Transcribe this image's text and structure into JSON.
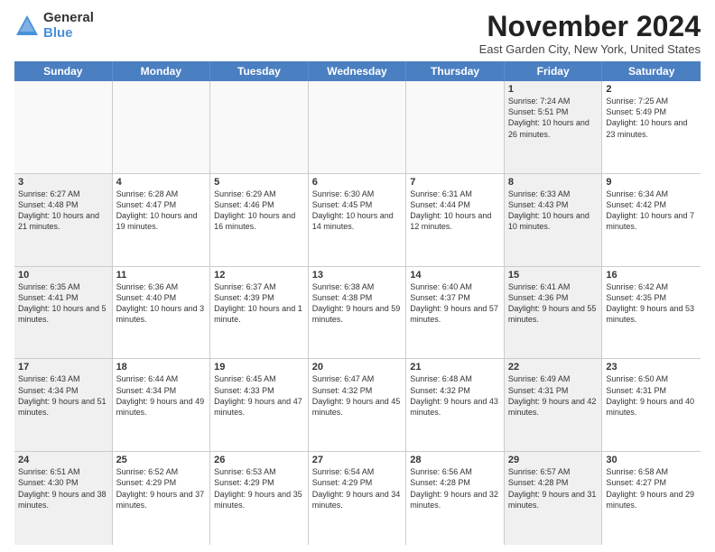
{
  "header": {
    "logo_general": "General",
    "logo_blue": "Blue",
    "month_title": "November 2024",
    "location": "East Garden City, New York, United States"
  },
  "weekdays": [
    "Sunday",
    "Monday",
    "Tuesday",
    "Wednesday",
    "Thursday",
    "Friday",
    "Saturday"
  ],
  "rows": [
    [
      {
        "day": "",
        "info": "",
        "empty": true
      },
      {
        "day": "",
        "info": "",
        "empty": true
      },
      {
        "day": "",
        "info": "",
        "empty": true
      },
      {
        "day": "",
        "info": "",
        "empty": true
      },
      {
        "day": "",
        "info": "",
        "empty": true
      },
      {
        "day": "1",
        "info": "Sunrise: 7:24 AM\nSunset: 5:51 PM\nDaylight: 10 hours and 26 minutes.",
        "shaded": true
      },
      {
        "day": "2",
        "info": "Sunrise: 7:25 AM\nSunset: 5:49 PM\nDaylight: 10 hours and 23 minutes.",
        "shaded": false
      }
    ],
    [
      {
        "day": "3",
        "info": "Sunrise: 6:27 AM\nSunset: 4:48 PM\nDaylight: 10 hours and 21 minutes.",
        "shaded": true
      },
      {
        "day": "4",
        "info": "Sunrise: 6:28 AM\nSunset: 4:47 PM\nDaylight: 10 hours and 19 minutes.",
        "shaded": false
      },
      {
        "day": "5",
        "info": "Sunrise: 6:29 AM\nSunset: 4:46 PM\nDaylight: 10 hours and 16 minutes.",
        "shaded": false
      },
      {
        "day": "6",
        "info": "Sunrise: 6:30 AM\nSunset: 4:45 PM\nDaylight: 10 hours and 14 minutes.",
        "shaded": false
      },
      {
        "day": "7",
        "info": "Sunrise: 6:31 AM\nSunset: 4:44 PM\nDaylight: 10 hours and 12 minutes.",
        "shaded": false
      },
      {
        "day": "8",
        "info": "Sunrise: 6:33 AM\nSunset: 4:43 PM\nDaylight: 10 hours and 10 minutes.",
        "shaded": true
      },
      {
        "day": "9",
        "info": "Sunrise: 6:34 AM\nSunset: 4:42 PM\nDaylight: 10 hours and 7 minutes.",
        "shaded": false
      }
    ],
    [
      {
        "day": "10",
        "info": "Sunrise: 6:35 AM\nSunset: 4:41 PM\nDaylight: 10 hours and 5 minutes.",
        "shaded": true
      },
      {
        "day": "11",
        "info": "Sunrise: 6:36 AM\nSunset: 4:40 PM\nDaylight: 10 hours and 3 minutes.",
        "shaded": false
      },
      {
        "day": "12",
        "info": "Sunrise: 6:37 AM\nSunset: 4:39 PM\nDaylight: 10 hours and 1 minute.",
        "shaded": false
      },
      {
        "day": "13",
        "info": "Sunrise: 6:38 AM\nSunset: 4:38 PM\nDaylight: 9 hours and 59 minutes.",
        "shaded": false
      },
      {
        "day": "14",
        "info": "Sunrise: 6:40 AM\nSunset: 4:37 PM\nDaylight: 9 hours and 57 minutes.",
        "shaded": false
      },
      {
        "day": "15",
        "info": "Sunrise: 6:41 AM\nSunset: 4:36 PM\nDaylight: 9 hours and 55 minutes.",
        "shaded": true
      },
      {
        "day": "16",
        "info": "Sunrise: 6:42 AM\nSunset: 4:35 PM\nDaylight: 9 hours and 53 minutes.",
        "shaded": false
      }
    ],
    [
      {
        "day": "17",
        "info": "Sunrise: 6:43 AM\nSunset: 4:34 PM\nDaylight: 9 hours and 51 minutes.",
        "shaded": true
      },
      {
        "day": "18",
        "info": "Sunrise: 6:44 AM\nSunset: 4:34 PM\nDaylight: 9 hours and 49 minutes.",
        "shaded": false
      },
      {
        "day": "19",
        "info": "Sunrise: 6:45 AM\nSunset: 4:33 PM\nDaylight: 9 hours and 47 minutes.",
        "shaded": false
      },
      {
        "day": "20",
        "info": "Sunrise: 6:47 AM\nSunset: 4:32 PM\nDaylight: 9 hours and 45 minutes.",
        "shaded": false
      },
      {
        "day": "21",
        "info": "Sunrise: 6:48 AM\nSunset: 4:32 PM\nDaylight: 9 hours and 43 minutes.",
        "shaded": false
      },
      {
        "day": "22",
        "info": "Sunrise: 6:49 AM\nSunset: 4:31 PM\nDaylight: 9 hours and 42 minutes.",
        "shaded": true
      },
      {
        "day": "23",
        "info": "Sunrise: 6:50 AM\nSunset: 4:31 PM\nDaylight: 9 hours and 40 minutes.",
        "shaded": false
      }
    ],
    [
      {
        "day": "24",
        "info": "Sunrise: 6:51 AM\nSunset: 4:30 PM\nDaylight: 9 hours and 38 minutes.",
        "shaded": true
      },
      {
        "day": "25",
        "info": "Sunrise: 6:52 AM\nSunset: 4:29 PM\nDaylight: 9 hours and 37 minutes.",
        "shaded": false
      },
      {
        "day": "26",
        "info": "Sunrise: 6:53 AM\nSunset: 4:29 PM\nDaylight: 9 hours and 35 minutes.",
        "shaded": false
      },
      {
        "day": "27",
        "info": "Sunrise: 6:54 AM\nSunset: 4:29 PM\nDaylight: 9 hours and 34 minutes.",
        "shaded": false
      },
      {
        "day": "28",
        "info": "Sunrise: 6:56 AM\nSunset: 4:28 PM\nDaylight: 9 hours and 32 minutes.",
        "shaded": false
      },
      {
        "day": "29",
        "info": "Sunrise: 6:57 AM\nSunset: 4:28 PM\nDaylight: 9 hours and 31 minutes.",
        "shaded": true
      },
      {
        "day": "30",
        "info": "Sunrise: 6:58 AM\nSunset: 4:27 PM\nDaylight: 9 hours and 29 minutes.",
        "shaded": false
      }
    ]
  ]
}
